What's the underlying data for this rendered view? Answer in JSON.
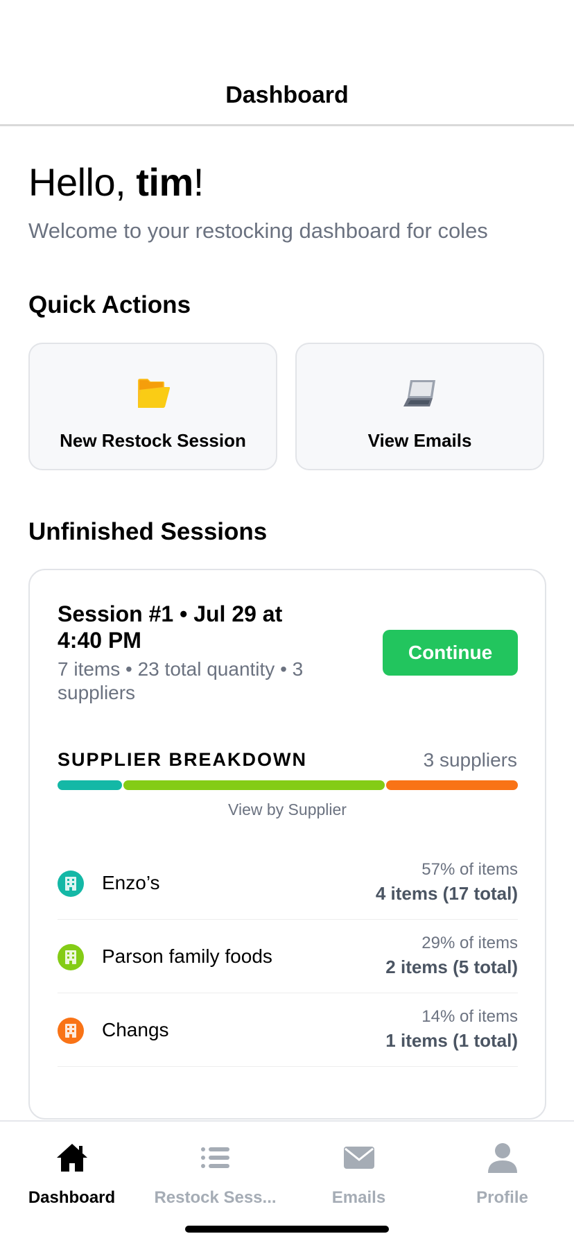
{
  "header": {
    "title": "Dashboard"
  },
  "greeting": {
    "hello": "Hello, ",
    "name": "tim",
    "exclaim": "!",
    "welcome": "Welcome to your restocking dashboard for coles"
  },
  "quick_actions": {
    "title": "Quick Actions",
    "items": [
      {
        "label": "New Restock Session",
        "icon": "folder-icon"
      },
      {
        "label": "View Emails",
        "icon": "laptop-icon"
      }
    ]
  },
  "unfinished": {
    "title": "Unfinished Sessions",
    "session": {
      "title": "Session #1 • Jul 29 at 4:40 PM",
      "subtitle": "7 items • 23 total quantity • 3 suppliers",
      "continue_label": "Continue",
      "breakdown_label": "SUPPLIER BREAKDOWN",
      "breakdown_count": "3 suppliers",
      "view_by": "View by Supplier",
      "suppliers": [
        {
          "name": "Enzo’s",
          "pct": "57% of items",
          "items": "4 items (17 total)",
          "share": 0.143,
          "color": "#14b8a6"
        },
        {
          "name": "Parson family foods",
          "pct": "29% of items",
          "items": "2 items (5 total)",
          "share": 0.571,
          "color": "#84cc16"
        },
        {
          "name": "Changs",
          "pct": "14% of items",
          "items": "1 items (1 total)",
          "share": 0.286,
          "color": "#f97316"
        }
      ]
    }
  },
  "tabs": [
    {
      "label": "Dashboard",
      "icon": "home-icon",
      "active": true
    },
    {
      "label": "Restock Sess...",
      "icon": "list-icon",
      "active": false
    },
    {
      "label": "Emails",
      "icon": "mail-icon",
      "active": false
    },
    {
      "label": "Profile",
      "icon": "person-icon",
      "active": false
    }
  ]
}
